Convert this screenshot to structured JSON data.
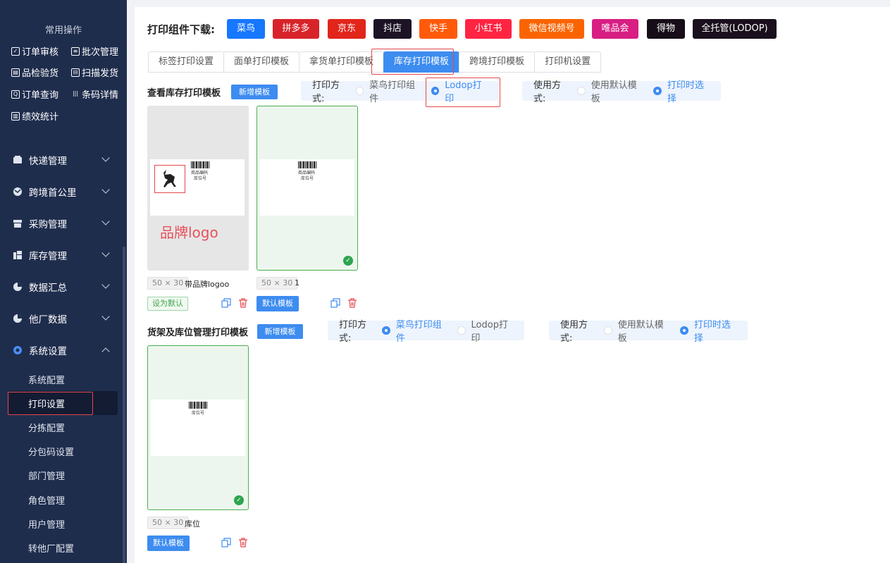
{
  "sidebar": {
    "common_title": "常用操作",
    "quick_ops": [
      {
        "label": "订单审核",
        "icon": "check-square-icon"
      },
      {
        "label": "批次管理",
        "icon": "batch-icon"
      },
      {
        "label": "品检验货",
        "icon": "inspect-icon"
      },
      {
        "label": "扫描发货",
        "icon": "scan-icon"
      },
      {
        "label": "订单查询",
        "icon": "search-order-icon"
      },
      {
        "label": "条码详情",
        "icon": "barcode-icon"
      },
      {
        "label": "绩效统计",
        "icon": "stats-icon"
      }
    ],
    "menus": [
      {
        "label": "快递管理",
        "icon": "truck-icon"
      },
      {
        "label": "跨境首公里",
        "icon": "globe-icon"
      },
      {
        "label": "采购管理",
        "icon": "store-icon"
      },
      {
        "label": "库存管理",
        "icon": "inventory-icon"
      },
      {
        "label": "数据汇总",
        "icon": "pie-chart-icon"
      },
      {
        "label": "他厂数据",
        "icon": "pie-chart-icon"
      },
      {
        "label": "系统设置",
        "icon": "settings-icon"
      }
    ],
    "sub_items": [
      "系统配置",
      "打印设置",
      "分拣配置",
      "分包码设置",
      "部门管理",
      "角色管理",
      "用户管理",
      "转他厂配置"
    ],
    "active_sub": "打印设置"
  },
  "download": {
    "title": "打印组件下载:",
    "brands": [
      {
        "label": "菜鸟",
        "color": "#1677ff"
      },
      {
        "label": "拼多多",
        "color": "#d8232a"
      },
      {
        "label": "京东",
        "color": "#e1251b"
      },
      {
        "label": "抖店",
        "color": "#1c1325"
      },
      {
        "label": "快手",
        "color": "#ff5a0a"
      },
      {
        "label": "小红书",
        "color": "#ff2442"
      },
      {
        "label": "微信视频号",
        "color": "#fa6400"
      },
      {
        "label": "唯品会",
        "color": "#d81e83"
      },
      {
        "label": "得物",
        "color": "#160d18"
      },
      {
        "label": "全托管(LODOP)",
        "color": "#1a0f1c"
      }
    ]
  },
  "tabs": [
    "标签打印设置",
    "面单打印模板",
    "拿货单打印模板",
    "库存打印模板",
    "跨境打印模板",
    "打印机设置"
  ],
  "active_tab": "库存打印模板",
  "section1": {
    "title": "查看库存打印模板",
    "add_label": "新增模板",
    "print_mode_label": "打印方式:",
    "print_modes": [
      "菜鸟打印组件",
      "Lodop打印"
    ],
    "print_mode_selected": "Lodop打印",
    "use_mode_label": "使用方式:",
    "use_modes": [
      "使用默认模板",
      "打印时选择"
    ],
    "use_mode_selected": "打印时选择",
    "templates": [
      {
        "size": "50 × 30",
        "name": "带品牌logoo",
        "action": "设为默认",
        "label_code": "商品编码",
        "label_loc": "库位号",
        "annotation": "品牌logo"
      },
      {
        "size": "50 × 30",
        "name": "1",
        "action": "默认模板",
        "label_code": "商品编码",
        "label_loc": "库位号"
      }
    ]
  },
  "section2": {
    "title": "货架及库位管理打印模板",
    "add_label": "新增模板",
    "print_mode_label": "打印方式:",
    "print_modes": [
      "菜鸟打印组件",
      "Lodop打印"
    ],
    "print_mode_selected": "菜鸟打印组件",
    "use_mode_label": "使用方式:",
    "use_modes": [
      "使用默认模板",
      "打印时选择"
    ],
    "use_mode_selected": "打印时选择",
    "templates": [
      {
        "size": "50 × 30",
        "name": "库位",
        "action": "默认模板",
        "label_loc": "库位号"
      }
    ]
  }
}
